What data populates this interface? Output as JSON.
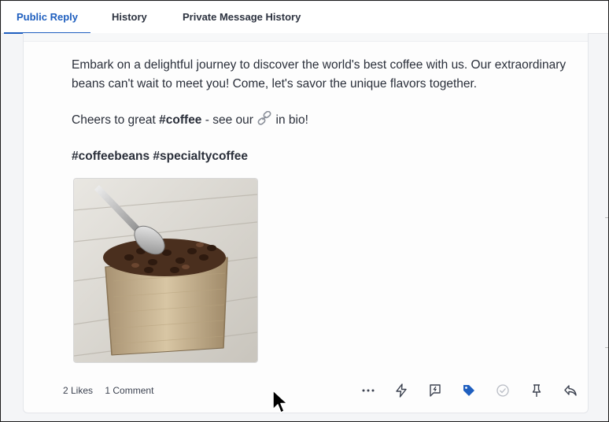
{
  "tabs": [
    {
      "label": "Public Reply",
      "active": true
    },
    {
      "label": "History",
      "active": false
    },
    {
      "label": "Private Message History",
      "active": false
    }
  ],
  "post": {
    "paragraph1": "Embark on a delightful journey to discover the world's best coffee with us. Our extraordinary beans can't wait to meet you! Come, let's savor the unique flavors together.",
    "cheers_prefix": "Cheers to great ",
    "cheers_hashtag": "#coffee",
    "cheers_middle": " - see our ",
    "cheers_suffix": " in bio!",
    "hashtags": "#coffeebeans #specialtycoffee",
    "image_icon": "coffee-beans-sack-photo"
  },
  "stats": {
    "likes": "2 Likes",
    "comments": "1 Comment"
  },
  "actions": [
    {
      "icon": "more-icon"
    },
    {
      "icon": "lightning-icon"
    },
    {
      "icon": "reply-bubble-icon"
    },
    {
      "icon": "tag-icon",
      "color": "#1f5fbf"
    },
    {
      "icon": "check-circle-icon"
    },
    {
      "icon": "pin-icon"
    },
    {
      "icon": "reply-arrow-icon"
    }
  ],
  "colors": {
    "accent": "#1f5fbf",
    "text": "#2a2f3a",
    "muted": "#3c4250"
  }
}
